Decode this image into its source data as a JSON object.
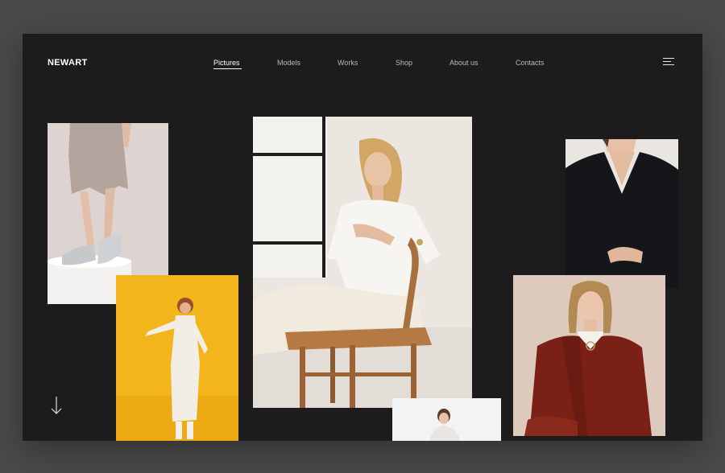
{
  "brand": {
    "logo_text": "NEWART"
  },
  "nav": {
    "items": [
      {
        "label": "Pictures",
        "active": true
      },
      {
        "label": "Models",
        "active": false
      },
      {
        "label": "Works",
        "active": false
      },
      {
        "label": "Shop",
        "active": false
      },
      {
        "label": "About us",
        "active": false
      },
      {
        "label": "Contacts",
        "active": false
      }
    ]
  },
  "header": {
    "menu_icon": "hamburger-menu-icon"
  },
  "gallery": {
    "photos": [
      {
        "name": "photo-sneakers-skirt",
        "subject": "legs in grey skirt and sneakers"
      },
      {
        "name": "photo-yellow-dress",
        "subject": "woman in white dress on yellow background"
      },
      {
        "name": "photo-woman-on-chair",
        "subject": "blonde woman seated on wooden chair"
      },
      {
        "name": "photo-black-top",
        "subject": "woman in black v-neck top"
      },
      {
        "name": "photo-red-coat",
        "subject": "woman in red coat"
      },
      {
        "name": "photo-small-portrait",
        "subject": "small portrait on white background"
      }
    ]
  },
  "scroll": {
    "icon": "arrow-down-icon"
  },
  "colors": {
    "page_bg": "#4a4a4a",
    "frame_bg": "#1c1c1c",
    "nav_text": "#b9b9b9",
    "nav_active": "#ffffff",
    "yellow_backdrop": "#f2b51c",
    "coat_red": "#7a2016"
  }
}
